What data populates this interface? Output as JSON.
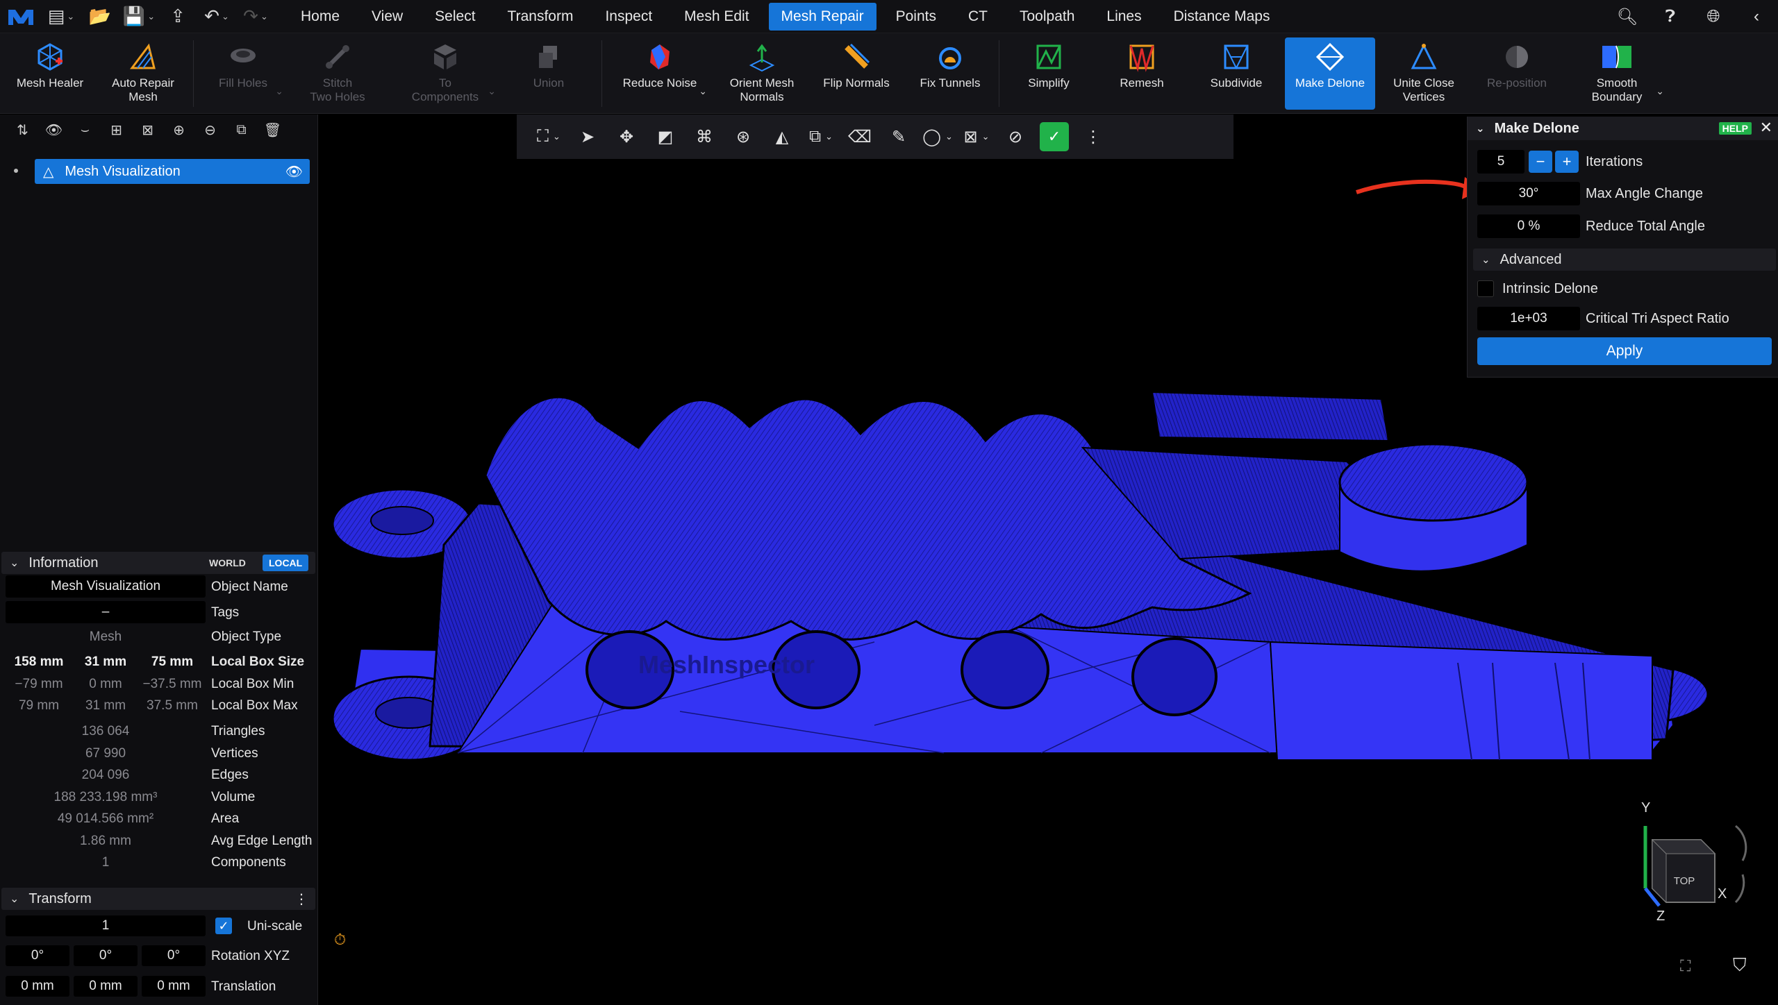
{
  "menubar": {
    "tabs": [
      "Home",
      "View",
      "Select",
      "Transform",
      "Inspect",
      "Mesh Edit",
      "Mesh Repair",
      "Points",
      "CT",
      "Toolpath",
      "Lines",
      "Distance Maps"
    ],
    "active_tab": "Mesh Repair"
  },
  "ribbon": {
    "tools": [
      {
        "label": "Mesh Healer",
        "icon": "mesh-healer-icon"
      },
      {
        "label": "Auto Repair\nMesh",
        "icon": "auto-repair-icon"
      },
      {
        "label": "Fill Holes",
        "icon": "fill-holes-icon"
      },
      {
        "label": "Stitch\nTwo Holes",
        "icon": "stitch-icon"
      },
      {
        "label": "To\nComponents",
        "icon": "components-icon"
      },
      {
        "label": "Union",
        "icon": "union-icon"
      },
      {
        "label": "Reduce Noise",
        "icon": "reduce-noise-icon"
      },
      {
        "label": "Orient Mesh\nNormals",
        "icon": "orient-normals-icon"
      },
      {
        "label": "Flip Normals",
        "icon": "flip-normals-icon"
      },
      {
        "label": "Fix Tunnels",
        "icon": "fix-tunnels-icon"
      },
      {
        "label": "Simplify",
        "icon": "simplify-icon"
      },
      {
        "label": "Remesh",
        "icon": "remesh-icon"
      },
      {
        "label": "Subdivide",
        "icon": "subdivide-icon"
      },
      {
        "label": "Make Delone",
        "icon": "make-delone-icon"
      },
      {
        "label": "Unite Close\nVertices",
        "icon": "unite-vertices-icon"
      },
      {
        "label": "Re-position",
        "icon": "reposition-icon"
      },
      {
        "label": "Smooth\nBoundary",
        "icon": "smooth-boundary-icon"
      }
    ]
  },
  "scene": {
    "object_name": "Mesh Visualization"
  },
  "information": {
    "title": "Information",
    "world_label": "WORLD",
    "local_label": "LOCAL",
    "object_name_value": "Mesh Visualization",
    "object_name_key": "Object Name",
    "tags_value": "–",
    "tags_key": "Tags",
    "object_type_value": "Mesh",
    "object_type_key": "Object Type",
    "box_size": [
      "158 mm",
      "31 mm",
      "75 mm"
    ],
    "box_size_key": "Local Box Size",
    "box_min": [
      "−79 mm",
      "0 mm",
      "−37.5 mm"
    ],
    "box_min_key": "Local Box Min",
    "box_max": [
      "79 mm",
      "31 mm",
      "37.5 mm"
    ],
    "box_max_key": "Local Box Max",
    "triangles_value": "136 064",
    "triangles_key": "Triangles",
    "vertices_value": "67 990",
    "vertices_key": "Vertices",
    "edges_value": "204 096",
    "edges_key": "Edges",
    "volume_value": "188 233.198 mm³",
    "volume_key": "Volume",
    "area_value": "49 014.566 mm²",
    "area_key": "Area",
    "avg_edge_value": "1.86 mm",
    "avg_edge_key": "Avg Edge Length",
    "components_value": "1",
    "components_key": "Components"
  },
  "transform": {
    "title": "Transform",
    "scale_value": "1",
    "uniscale_label": "Uni-scale",
    "rotation": [
      "0°",
      "0°",
      "0°"
    ],
    "rotation_key": "Rotation XYZ",
    "translation": [
      "0 mm",
      "0 mm",
      "0 mm"
    ],
    "translation_key": "Translation"
  },
  "delone": {
    "title": "Make Delone",
    "help_label": "HELP",
    "iterations_value": "5",
    "iterations_label": "Iterations",
    "max_angle_value": "30°",
    "max_angle_label": "Max Angle Change",
    "reduce_angle_value": "0 %",
    "reduce_angle_label": "Reduce Total Angle",
    "advanced_label": "Advanced",
    "intrinsic_label": "Intrinsic Delone",
    "aspect_value": "1e+03",
    "aspect_label": "Critical Tri Aspect Ratio",
    "apply_label": "Apply"
  },
  "viewport": {
    "watermark": "MeshInspector",
    "cube_face": "TOP",
    "axis_x": "X",
    "axis_y": "Y",
    "axis_z": "Z"
  },
  "colors": {
    "accent": "#1675d8",
    "mesh": "#2a2ae0",
    "success": "#21b24a",
    "arrow": "#e8321e"
  }
}
